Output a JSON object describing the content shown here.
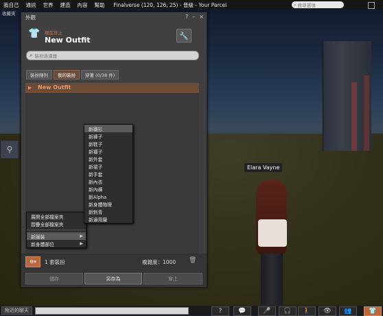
{
  "menubar": {
    "items": [
      "我自己",
      "通訊",
      "世界",
      "建造",
      "內容",
      "幫助"
    ],
    "location": "Finalverse (120, 126, 25) - 普級 - Your Parcel",
    "search_placeholder": "搜尋選項"
  },
  "left": {
    "tab_label": "收藏夾"
  },
  "scene": {
    "avatar_name": "Elara Vayne"
  },
  "floater": {
    "title": "外觀",
    "ctrl_help": "?",
    "ctrl_min": "–",
    "ctrl_close": "×",
    "wearing_label": "現在穿上",
    "outfit_name": "New Outfit",
    "filter_placeholder": "裝扮過濾器",
    "tabs": [
      {
        "label": "裝扮陳列",
        "active": false
      },
      {
        "label": "我的裝扮",
        "active": true
      },
      {
        "label": "穿著 (0/38 件)",
        "active": false
      }
    ],
    "list": [
      {
        "name": "New Outfit"
      }
    ],
    "outfit_count": "1 套裝扮",
    "complexity": "複雜度：1000",
    "buttons": {
      "save": "儲存",
      "save_as": "另存為",
      "wear": "穿上"
    }
  },
  "gear_menu": {
    "items": [
      "展開全部檔案夾",
      "摺疊全部檔案夾"
    ],
    "submenus": [
      "新服裝",
      "新身體部位"
    ]
  },
  "clothing_submenu": {
    "items": [
      "新襯衫",
      "新褲子",
      "新鞋子",
      "新襪子",
      "新外套",
      "新裙子",
      "新手套",
      "新內衣",
      "新內褲",
      "新Alpha",
      "新身體物理",
      "新刺青",
      "新通用層"
    ]
  },
  "bottombar": {
    "chat_label": "附近的聊天"
  },
  "colors": {
    "accent": "#b6683f",
    "outfit_text": "#e39c6f"
  }
}
